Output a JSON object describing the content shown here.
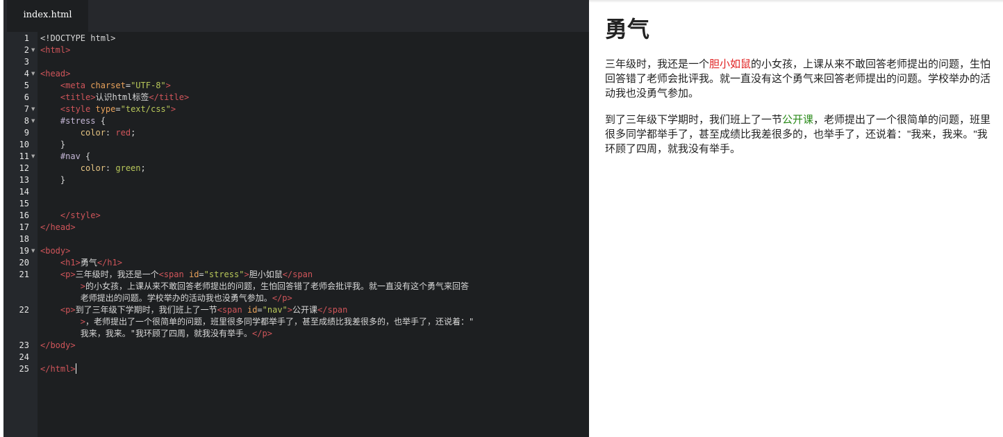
{
  "editor": {
    "tab_label": "index.html",
    "lines": [
      {
        "n": "1",
        "fold": false,
        "tokens": [
          [
            "txt",
            "<!DOCTYPE html>"
          ]
        ]
      },
      {
        "n": "2",
        "fold": true,
        "tokens": [
          [
            "tag",
            "<html>"
          ]
        ]
      },
      {
        "n": "3",
        "fold": false,
        "tokens": []
      },
      {
        "n": "4",
        "fold": true,
        "tokens": [
          [
            "tag",
            "<head>"
          ]
        ]
      },
      {
        "n": "5",
        "fold": false,
        "tokens": [
          [
            "txt",
            "    "
          ],
          [
            "tag",
            "<meta "
          ],
          [
            "attr",
            "charset"
          ],
          [
            "txt",
            "="
          ],
          [
            "str",
            "\"UTF-8\""
          ],
          [
            "tag",
            ">"
          ]
        ]
      },
      {
        "n": "6",
        "fold": false,
        "tokens": [
          [
            "txt",
            "    "
          ],
          [
            "tag",
            "<title>"
          ],
          [
            "txt",
            "认识html标签"
          ],
          [
            "tag",
            "</title>"
          ]
        ]
      },
      {
        "n": "7",
        "fold": true,
        "tokens": [
          [
            "txt",
            "    "
          ],
          [
            "tag",
            "<style "
          ],
          [
            "attr",
            "type"
          ],
          [
            "txt",
            "="
          ],
          [
            "str",
            "\"text/css\""
          ],
          [
            "tag",
            ">"
          ]
        ]
      },
      {
        "n": "8",
        "fold": true,
        "tokens": [
          [
            "txt",
            "    "
          ],
          [
            "sel",
            "#stress"
          ],
          [
            "txt",
            " {"
          ]
        ]
      },
      {
        "n": "9",
        "fold": false,
        "tokens": [
          [
            "txt",
            "        "
          ],
          [
            "prop",
            "color"
          ],
          [
            "txt",
            ": "
          ],
          [
            "val",
            "red"
          ],
          [
            "txt",
            ";"
          ]
        ]
      },
      {
        "n": "10",
        "fold": false,
        "tokens": [
          [
            "txt",
            "    }"
          ]
        ]
      },
      {
        "n": "11",
        "fold": true,
        "tokens": [
          [
            "txt",
            "    "
          ],
          [
            "sel",
            "#nav"
          ],
          [
            "txt",
            " {"
          ]
        ]
      },
      {
        "n": "12",
        "fold": false,
        "tokens": [
          [
            "txt",
            "        "
          ],
          [
            "prop",
            "color"
          ],
          [
            "txt",
            ": "
          ],
          [
            "str",
            "green"
          ],
          [
            "txt",
            ";"
          ]
        ]
      },
      {
        "n": "13",
        "fold": false,
        "tokens": [
          [
            "txt",
            "    }"
          ]
        ]
      },
      {
        "n": "14",
        "fold": false,
        "tokens": []
      },
      {
        "n": "15",
        "fold": false,
        "tokens": []
      },
      {
        "n": "16",
        "fold": false,
        "tokens": [
          [
            "txt",
            "    "
          ],
          [
            "tag",
            "</style>"
          ]
        ]
      },
      {
        "n": "17",
        "fold": false,
        "tokens": [
          [
            "tag",
            "</head>"
          ]
        ]
      },
      {
        "n": "18",
        "fold": false,
        "tokens": []
      },
      {
        "n": "19",
        "fold": true,
        "tokens": [
          [
            "tag",
            "<body>"
          ]
        ]
      },
      {
        "n": "20",
        "fold": false,
        "tokens": [
          [
            "txt",
            "    "
          ],
          [
            "tag",
            "<h1>"
          ],
          [
            "txt",
            "勇气"
          ],
          [
            "tag",
            "</h1>"
          ]
        ]
      },
      {
        "n": "21",
        "fold": false,
        "tokens": [
          [
            "txt",
            "    "
          ],
          [
            "tag",
            "<p>"
          ],
          [
            "txt",
            "三年级时，我还是一个"
          ],
          [
            "tag",
            "<span "
          ],
          [
            "attr",
            "id"
          ],
          [
            "txt",
            "="
          ],
          [
            "str",
            "\"stress\""
          ],
          [
            "tag",
            ">"
          ],
          [
            "txt",
            "胆小如鼠"
          ],
          [
            "tag",
            "</span"
          ]
        ]
      },
      {
        "n": "",
        "fold": false,
        "tokens": [
          [
            "txt",
            "        "
          ],
          [
            "tag",
            ">"
          ],
          [
            "txt",
            "的小女孩，上课从来不敢回答老师提出的问题，生怕回答错了老师会批评我。就一直没有这个勇气来回答"
          ]
        ]
      },
      {
        "n": "",
        "fold": false,
        "tokens": [
          [
            "txt",
            "        老师提出的问题。学校举办的活动我也没勇气参加。"
          ],
          [
            "tag",
            "</p>"
          ]
        ]
      },
      {
        "n": "22",
        "fold": false,
        "tokens": [
          [
            "txt",
            "    "
          ],
          [
            "tag",
            "<p>"
          ],
          [
            "txt",
            "到了三年级下学期时，我们班上了一节"
          ],
          [
            "tag",
            "<span "
          ],
          [
            "attr",
            "id"
          ],
          [
            "txt",
            "="
          ],
          [
            "str",
            "\"nav\""
          ],
          [
            "tag",
            ">"
          ],
          [
            "txt",
            "公开课"
          ],
          [
            "tag",
            "</span"
          ]
        ]
      },
      {
        "n": "",
        "fold": false,
        "tokens": [
          [
            "txt",
            "        "
          ],
          [
            "tag",
            ">"
          ],
          [
            "txt",
            "，老师提出了一个很简单的问题，班里很多同学都举手了，甚至成绩比我差很多的，也举手了，还说着：\""
          ]
        ]
      },
      {
        "n": "",
        "fold": false,
        "tokens": [
          [
            "txt",
            "        我来，我来。\"我环顾了四周，就我没有举手。"
          ],
          [
            "tag",
            "</p>"
          ]
        ]
      },
      {
        "n": "23",
        "fold": false,
        "tokens": [
          [
            "tag",
            "</body>"
          ]
        ]
      },
      {
        "n": "24",
        "fold": false,
        "tokens": []
      },
      {
        "n": "25",
        "fold": false,
        "tokens": [
          [
            "tag",
            "</html>"
          ]
        ],
        "cursor": true
      }
    ]
  },
  "preview": {
    "title": "勇气",
    "p1": {
      "before": "三年级时，我还是一个",
      "highlight": "胆小如鼠",
      "after": "的小女孩，上课从来不敢回答老师提出的问题，生怕回答错了老师会批评我。就一直没有这个勇气来回答老师提出的问题。学校举办的活动我也没勇气参加。"
    },
    "p2": {
      "before": "到了三年级下学期时，我们班上了一节",
      "highlight": "公开课",
      "after": "，老师提出了一个很简单的问题，班里很多同学都举手了，甚至成绩比我差很多的，也举手了，还说着：\"我来，我来。\"我环顾了四周，就我没有举手。"
    }
  },
  "colors": {
    "editor_bg": "#1d1f21",
    "tag": "#d0555a",
    "attribute": "#e9a25b",
    "string": "#b8c75a",
    "stress_red": "#e02020",
    "nav_green": "#2a8a1a"
  }
}
